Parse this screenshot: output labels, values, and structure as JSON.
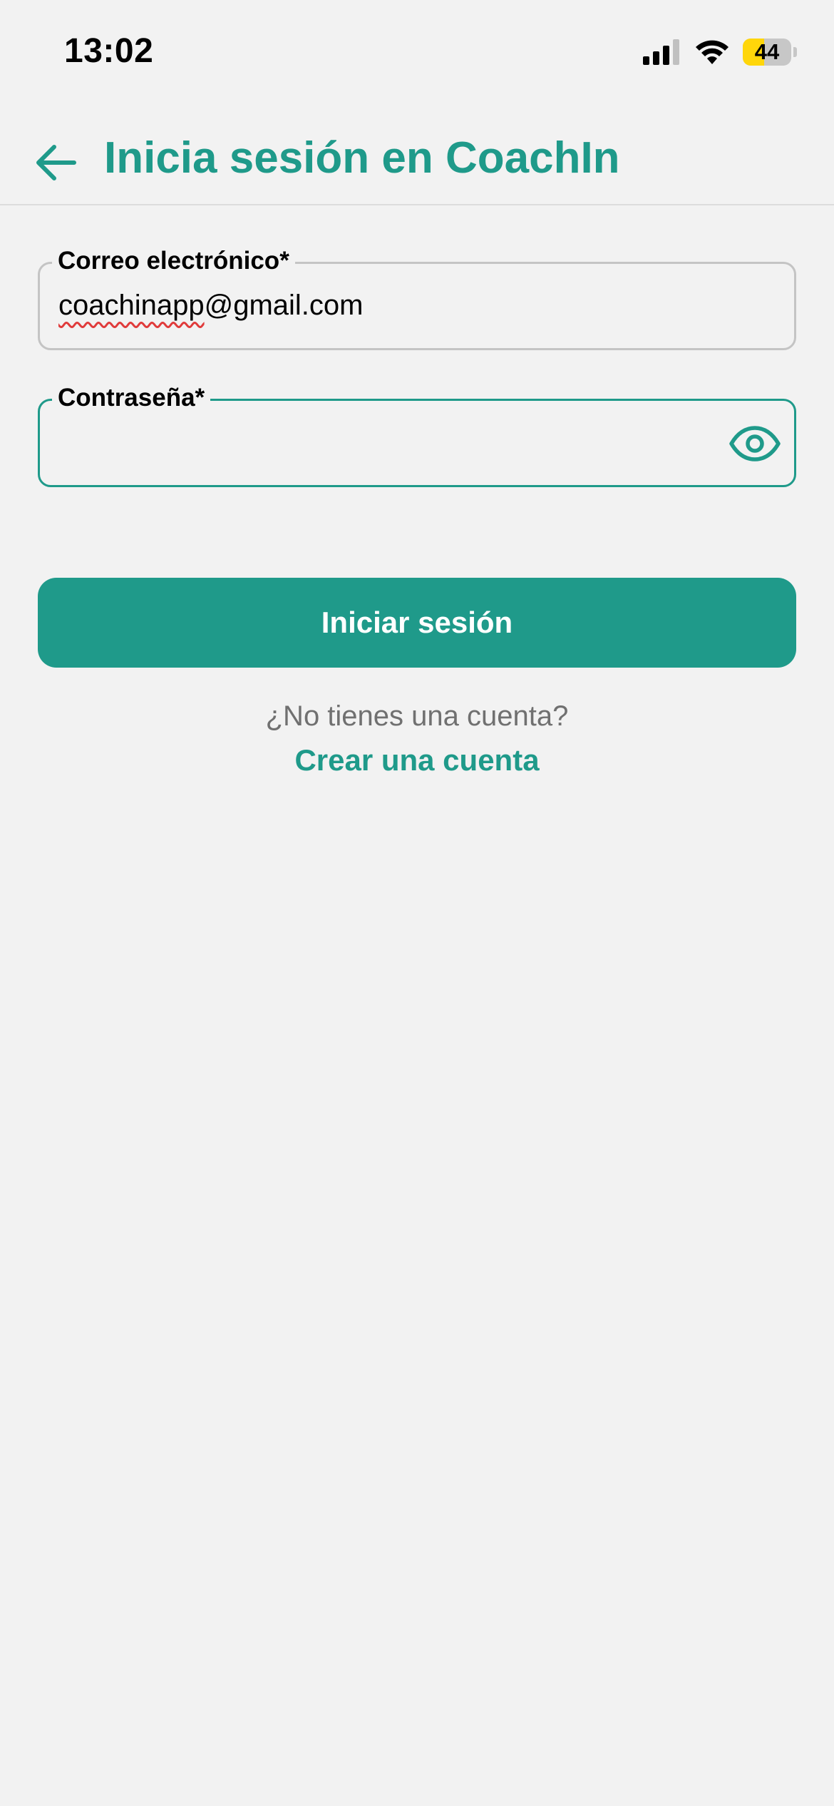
{
  "status_bar": {
    "time": "13:02",
    "battery_level": "44",
    "battery_fraction": 0.44,
    "icons": [
      "cellular-signal-icon",
      "wifi-icon",
      "battery-icon"
    ]
  },
  "header": {
    "back_icon": "arrow-left-icon",
    "title": "Inicia sesión en CoachIn"
  },
  "form": {
    "email": {
      "label": "Correo electrónico*",
      "value_misspelled": "coachinapp",
      "value_rest": "@gmail.com"
    },
    "password": {
      "label": "Contraseña*",
      "value": "",
      "toggle_icon": "eye-icon"
    },
    "submit_label": "Iniciar sesión"
  },
  "signup": {
    "prompt": "¿No tienes una cuenta?",
    "link_label": "Crear una cuenta"
  },
  "colors": {
    "accent": "#1f9a8a",
    "background": "#f2f2f2",
    "border_inactive": "#c4c4c4",
    "muted_text": "#707070",
    "battery_fill": "#ffd60a"
  }
}
